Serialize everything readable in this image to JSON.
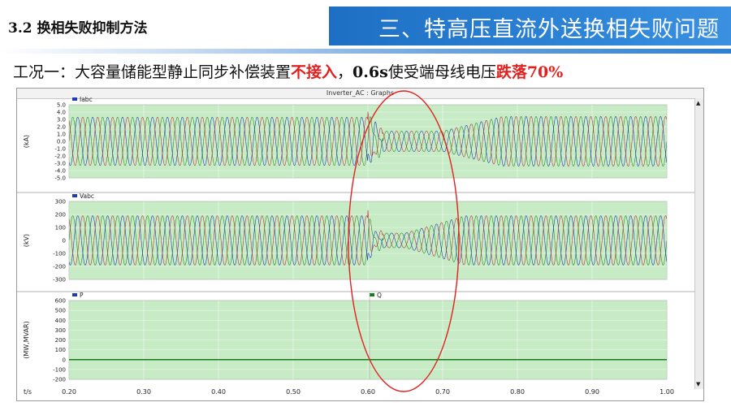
{
  "header": {
    "section_label": "3.2 换相失败抑制方法",
    "banner_title": "三、特高压直流外送换相失败问题"
  },
  "condition": {
    "prefix": "工况一：大容量储能型静止同步补偿装置",
    "red1": "不接入",
    "middle1": "，",
    "bold_time": "0.6s",
    "middle2": "使受端母线电压",
    "red2": "跌落70%"
  },
  "colors": {
    "banner": "#2f86d8",
    "plot_bg": "#c7ebc5",
    "phase_a": "#2a8a2a",
    "phase_b": "#1d3bb8",
    "phase_c": "#b8343a",
    "circle": "#e0211f",
    "q_line": "#1a7a1a"
  },
  "chart_data": {
    "type": "line",
    "title": "Inverter_AC : Graphs",
    "xlabel": "t/s",
    "xlim": [
      0.2,
      1.0
    ],
    "x_ticks": [
      "0.20",
      "0.30",
      "0.40",
      "0.50",
      "0.60",
      "0.70",
      "0.80",
      "0.90",
      "1.00"
    ],
    "panels": [
      {
        "ylabel": "(kA)",
        "ylim": [
          -5.0,
          5.0
        ],
        "y_ticks": [
          "5.0",
          "4.0",
          "3.0",
          "2.0",
          "1.0",
          "0.0",
          "-1.0",
          "-2.0",
          "-3.0",
          "-4.0",
          "-5.0"
        ],
        "legend": [
          "Iabc"
        ],
        "signal": {
          "amplitude_pre": 3.3,
          "amplitude_dip": 1.4,
          "amplitude_post": 3.4,
          "fault_start": 0.6,
          "fault_end": 0.7,
          "frequency_hz": 50
        }
      },
      {
        "ylabel": "(kV)",
        "ylim": [
          -300,
          300
        ],
        "y_ticks": [
          "300",
          "200",
          "100",
          "0",
          "-100",
          "-200",
          "-300"
        ],
        "legend": [
          "Vabc"
        ],
        "signal": {
          "amplitude_pre": 190,
          "amplitude_dip": 57,
          "amplitude_post": 190,
          "fault_start": 0.6,
          "fault_end": 0.65,
          "frequency_hz": 50
        }
      },
      {
        "ylabel": "(MW,MVAR)",
        "ylim": [
          -200,
          600
        ],
        "y_ticks": [
          "600",
          "500",
          "400",
          "300",
          "200",
          "100",
          "0",
          "-100",
          "-200"
        ],
        "legend": [
          "P",
          "Q"
        ],
        "series": [
          {
            "name": "P",
            "values_constant": 0
          },
          {
            "name": "Q",
            "values_constant": 0
          }
        ]
      }
    ]
  }
}
